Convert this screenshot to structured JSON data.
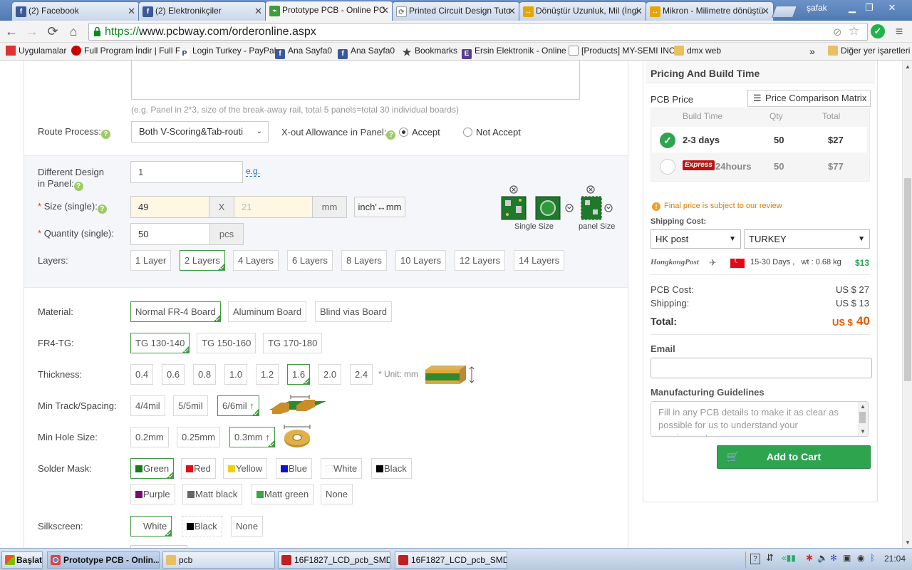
{
  "browser": {
    "tabs": [
      {
        "title": "(2) Facebook",
        "icon": "facebook-icon",
        "color": "#3b5998"
      },
      {
        "title": "(2) Elektronikçiler",
        "icon": "facebook-icon",
        "color": "#3b5998"
      },
      {
        "title": "Prototype PCB - Online PC",
        "icon": "pcbway-icon",
        "color": "#3d9c3d",
        "active": true
      },
      {
        "title": "Printed Circuit Design Tuto",
        "icon": "refresh-icon",
        "color": "#777777"
      },
      {
        "title": "Dönüştür Uzunluk, Mil (İngi",
        "icon": "convert-icon",
        "color": "#e6a500"
      },
      {
        "title": "Mikron - Milimetre dönüştü",
        "icon": "convert-icon",
        "color": "#e6a500"
      }
    ],
    "user": "şafak",
    "url_scheme": "https://",
    "url_rest": "www.pcbway.com/orderonline.aspx",
    "bookmarks": [
      "Uygulamalar",
      "Full Program İndir | Full F",
      "Login Turkey - PayPal",
      "Ana Sayfa0",
      "Ana Sayfa0",
      "Bookmarks",
      "Ersin Elektronik - Online",
      "[Products] MY-SEMI INC",
      "dmx web"
    ],
    "other_bookmarks": "Diğer yer işaretleri"
  },
  "form": {
    "panel_hint": "(e.g. Panel in 2*3, size of the break-away rail, total 5 panels=total 30 individual boards)",
    "route_label": "Route Process:",
    "route_value": "Both V-Scoring&Tab-routi",
    "xout_label": "X-out Allowance in Panel:",
    "accept": "Accept",
    "not_accept": "Not Accept",
    "diff_design_label1": "Different Design",
    "diff_design_label2": "in Panel:",
    "diff_design_value": "1",
    "eg": "e.g.",
    "size_label": "Size (single):",
    "size_x": "49",
    "size_sep": "X",
    "size_y_placeholder": "21",
    "size_unit": "mm",
    "unit_toggle": "inch'↔mm",
    "qty_label": "Quantity (single):",
    "qty_value": "50",
    "qty_unit": "pcs",
    "single_size": "Single Size",
    "panel_size": "panel Size",
    "layers_label": "Layers:",
    "layers": [
      "1 Layer",
      "2 Layers",
      "4 Layers",
      "6 Layers",
      "8 Layers",
      "10 Layers",
      "12 Layers",
      "14 Layers"
    ],
    "material_label": "Material:",
    "materials": [
      "Normal FR-4 Board",
      "Aluminum Board",
      "Blind vias Board"
    ],
    "tg_label": "FR4-TG:",
    "tgs": [
      "TG 130-140",
      "TG 150-160",
      "TG 170-180"
    ],
    "thickness_label": "Thickness:",
    "thicknesses": [
      "0.4",
      "0.6",
      "0.8",
      "1.0",
      "1.2",
      "1.6",
      "2.0",
      "2.4"
    ],
    "thickness_unit": "* Unit: mm",
    "track_label": "Min Track/Spacing:",
    "tracks": [
      "4/4mil",
      "5/5mil",
      "6/6mil ↑"
    ],
    "hole_label": "Min Hole Size:",
    "holes": [
      "0.2mm",
      "0.25mm",
      "0.3mm ↑"
    ],
    "mask_label": "Solder Mask:",
    "masks": [
      {
        "name": "Green",
        "color": "#1a7a1a"
      },
      {
        "name": "Red",
        "color": "#e01010"
      },
      {
        "name": "Yellow",
        "color": "#f2d000"
      },
      {
        "name": "Blue",
        "color": "#1010d0"
      },
      {
        "name": "White",
        "color": "#ffffff"
      },
      {
        "name": "Black",
        "color": "#000000"
      },
      {
        "name": "Purple",
        "color": "#7a0a7a"
      },
      {
        "name": "Matt black",
        "color": "#666666"
      },
      {
        "name": "Matt green",
        "color": "#3aa83a"
      },
      {
        "name": "None",
        "color": ""
      }
    ],
    "silk_label": "Silkscreen:",
    "silks": [
      {
        "name": "White",
        "color": "#ffffff"
      },
      {
        "name": "Black",
        "color": "#000000"
      },
      {
        "name": "None",
        "color": ""
      }
    ]
  },
  "pricing": {
    "title": "Pricing And Build Time",
    "pcb_price": "PCB Price",
    "matrix_btn": "Price Comparison Matrix",
    "col_build": "Build Time",
    "col_qty": "Qty",
    "col_total": "Total",
    "row1": {
      "build": "2-3 days",
      "qty": "50",
      "total": "$27"
    },
    "row2": {
      "badge": "Express",
      "build": "24hours",
      "qty": "50",
      "total": "$77"
    },
    "notice": "Final price is subject to our review",
    "shipping_label": "Shipping Cost:",
    "carrier": "HK post",
    "country": "TURKEY",
    "hkpost_logo": "HongkongPost",
    "ship_days": "15-30 Days ,   wt : 0.68 kg",
    "ship_price": "$13",
    "pcb_cost_label": "PCB Cost:",
    "pcb_cost": "US $ 27",
    "shipping_cost_label": "Shipping:",
    "shipping_cost": "US $ 13",
    "total_label": "Total:",
    "total_prefix": "US $",
    "total_value": "40",
    "email_label": "Email",
    "email_value": "",
    "guidelines_label": "Manufacturing Guidelines",
    "guidelines_placeholder": "Fill in any PCB details to make it as clear as possible for us to understand your requirements.",
    "add_to_cart": "Add to Cart"
  },
  "taskbar": {
    "start": "Başlat",
    "items": [
      "Prototype PCB - Onlin...",
      "pcb",
      "16F1827_LCD_pcb_SMD...",
      "16F1827_LCD_pcb_SMD..."
    ],
    "time": "21:04"
  }
}
